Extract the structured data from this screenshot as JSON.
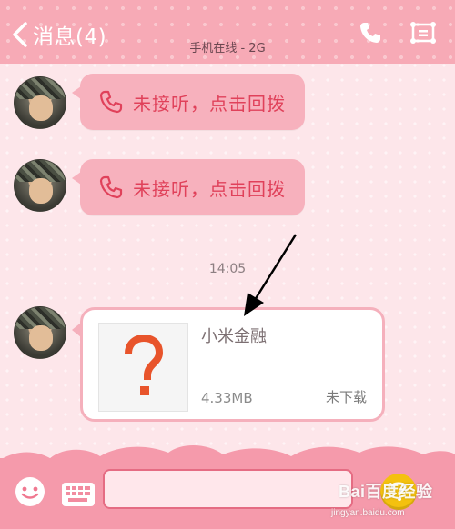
{
  "header": {
    "back_icon": "chevron-left-icon",
    "title": "消息(4)",
    "subtitle": "手机在线 - 2G",
    "phone_icon": "phone-icon",
    "profile_icon": "contact-card-icon"
  },
  "messages": [
    {
      "type": "missed_call",
      "icon": "missed-call-phone-icon",
      "label": "未接听，点击回拨"
    },
    {
      "type": "missed_call",
      "icon": "missed-call-phone-icon",
      "label": "未接听，点击回拨"
    }
  ],
  "timestamp": "14:05",
  "file_message": {
    "thumb_icon": "question-mark-icon",
    "name": "小米金融",
    "size": "4.33MB",
    "status": "未下载"
  },
  "input_bar": {
    "emoji_icon": "smiley-icon",
    "keyboard_icon": "keyboard-icon",
    "input_value": "",
    "input_placeholder": "",
    "send_icon": "send-icon"
  },
  "watermark": {
    "brand": "Bai百度经验",
    "url": "jingyan.baidu.com"
  },
  "colors": {
    "header_bg": "#f7aab6",
    "bubble_pink": "#f7b1bd",
    "missed_text": "#e0415a",
    "background": "#fde6ea",
    "bottom_bar": "#f59aab",
    "send_button": "#f4c10f"
  }
}
